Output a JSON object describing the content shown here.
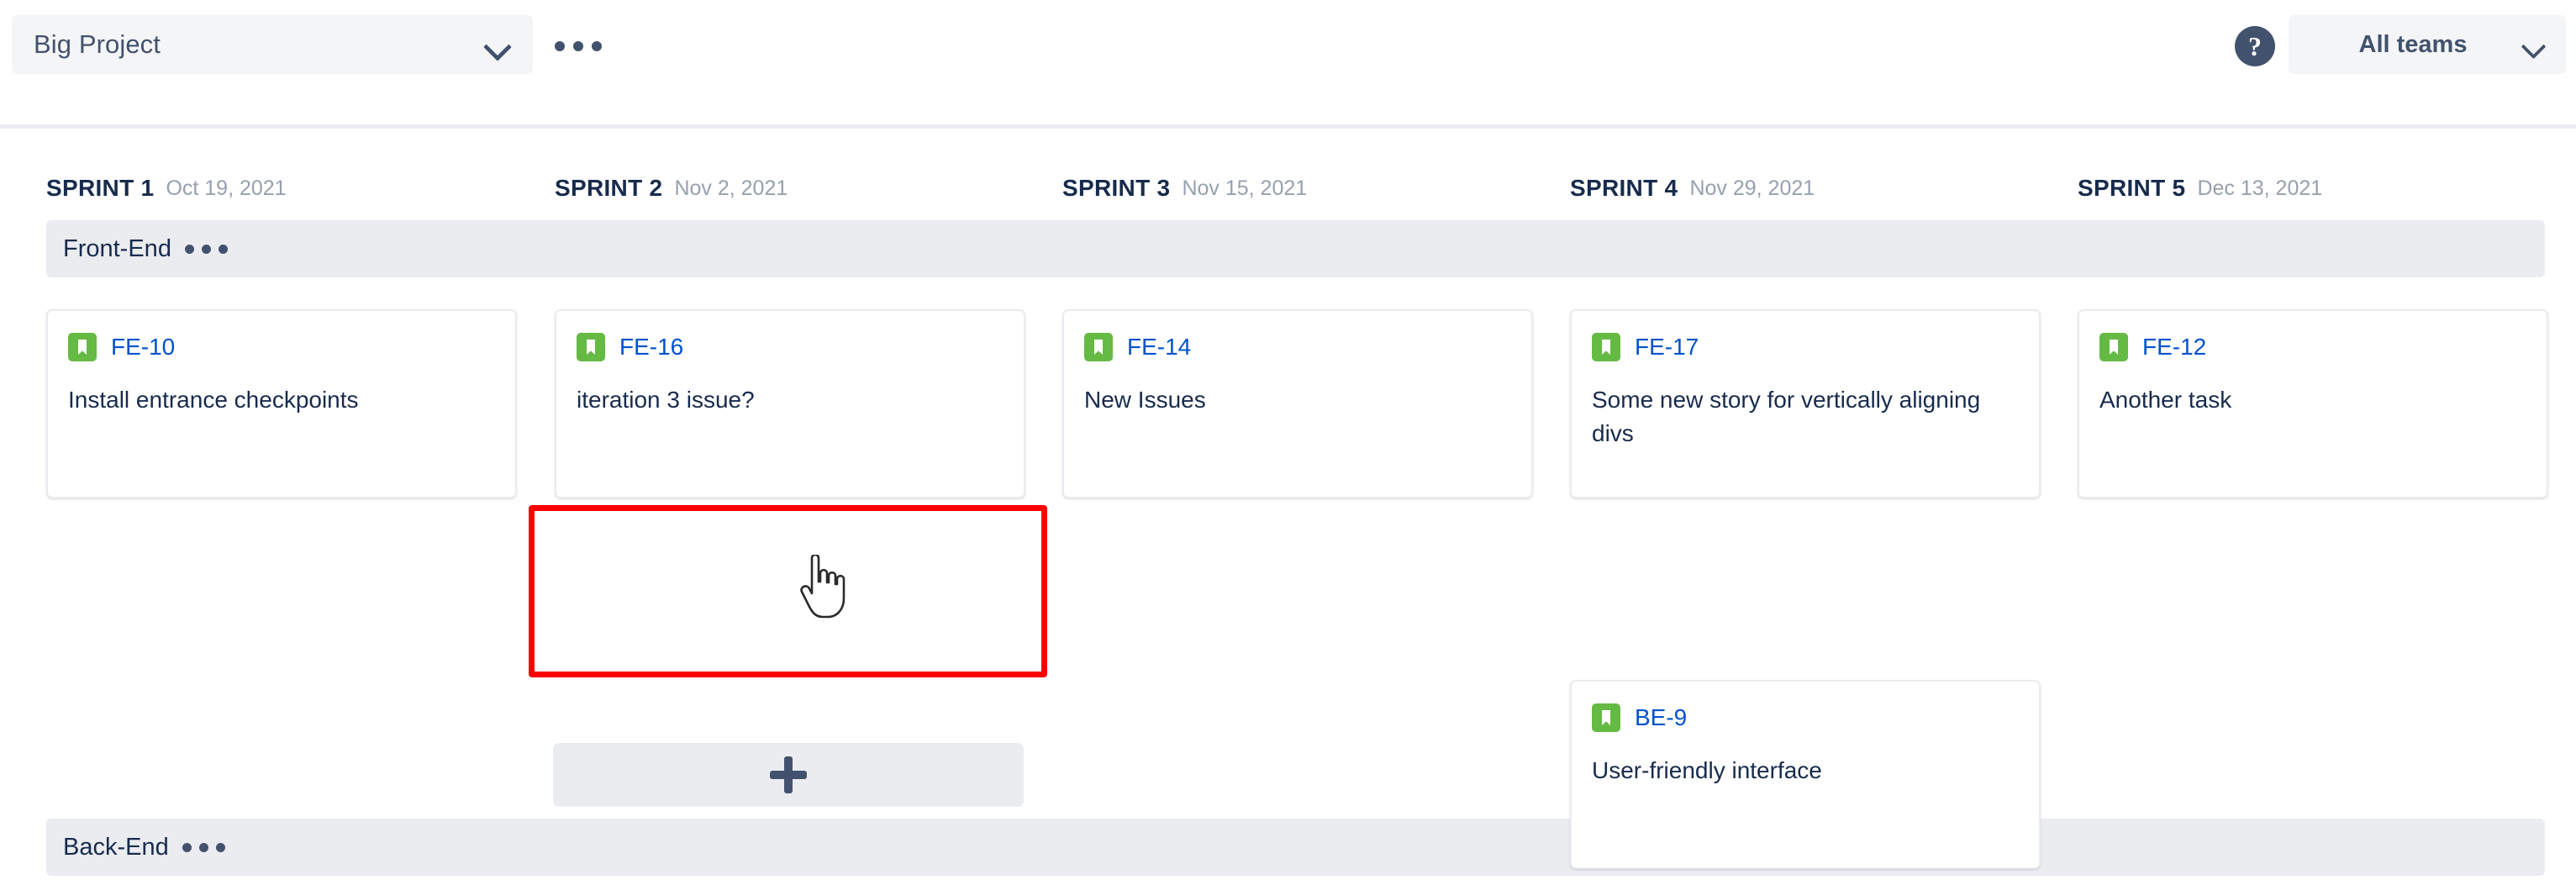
{
  "topbar": {
    "project_label": "Big Project",
    "more_icon": "ellipsis-icon",
    "help_icon": "?",
    "teams_label": "All teams",
    "chevron_icon": "chevron-down-icon"
  },
  "sprints": [
    {
      "name": "SPRINT 1",
      "date": "Oct 19, 2021"
    },
    {
      "name": "SPRINT 2",
      "date": "Nov 2, 2021"
    },
    {
      "name": "SPRINT 3",
      "date": "Nov 15, 2021"
    },
    {
      "name": "SPRINT 4",
      "date": "Nov 29, 2021"
    },
    {
      "name": "SPRINT 5",
      "date": "Dec 13, 2021"
    }
  ],
  "lanes": [
    {
      "title": "Front-End",
      "more_icon": "ellipsis-icon"
    },
    {
      "title": "Back-End",
      "more_icon": "ellipsis-icon"
    }
  ],
  "cards": [
    {
      "key": "FE-10",
      "title": "Install entrance checkpoints",
      "icon": "story-bookmark-icon"
    },
    {
      "key": "FE-16",
      "title": "iteration 3 issue?",
      "icon": "story-bookmark-icon"
    },
    {
      "key": "FE-14",
      "title": "New Issues",
      "icon": "story-bookmark-icon"
    },
    {
      "key": "FE-17",
      "title": "Some new story for vertically aligning divs",
      "icon": "story-bookmark-icon"
    },
    {
      "key": "FE-12",
      "title": "Another task",
      "icon": "story-bookmark-icon"
    },
    {
      "key": "BE-9",
      "title": "User-friendly interface",
      "icon": "story-bookmark-icon"
    }
  ],
  "add_slot": {
    "icon": "plus-icon"
  },
  "cursor": {
    "icon": "hand-pointer-cursor"
  },
  "colors": {
    "story_green": "#65ba43",
    "link_blue": "#0052cc",
    "text_dark": "#172b4d",
    "text_muted": "#97a0af",
    "lane_gray": "#ebecf0",
    "highlight_red": "#ff0000"
  }
}
